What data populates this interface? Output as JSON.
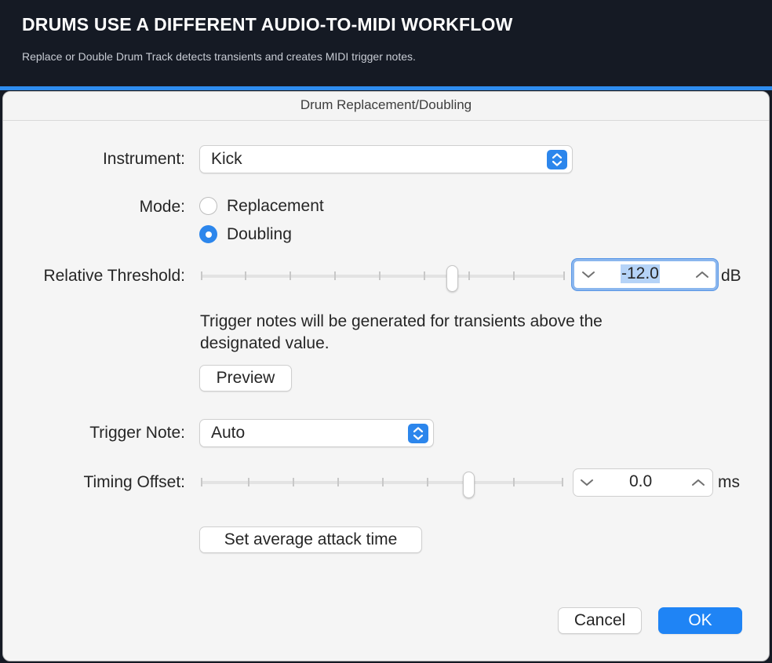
{
  "banner": {
    "title": "DRUMS USE A DIFFERENT AUDIO-TO-MIDI WORKFLOW",
    "subtitle": "Replace or Double Drum Track detects transients and creates MIDI trigger notes."
  },
  "dialog": {
    "title": "Drum Replacement/Doubling",
    "instrument": {
      "label": "Instrument:",
      "value": "Kick"
    },
    "mode": {
      "label": "Mode:",
      "options": [
        {
          "label": "Replacement",
          "selected": false
        },
        {
          "label": "Doubling",
          "selected": true
        }
      ]
    },
    "threshold": {
      "label": "Relative Threshold:",
      "value": "-12.0",
      "unit": "dB",
      "slider_position": 0.62,
      "help_line1": "Trigger notes will be generated for transients above the",
      "help_line2": "designated value.",
      "preview_label": "Preview"
    },
    "trigger_note": {
      "label": "Trigger Note:",
      "value": "Auto"
    },
    "timing_offset": {
      "label": "Timing Offset:",
      "value": "0.0",
      "unit": "ms",
      "slider_position": 0.74,
      "attack_button_label": "Set average attack time"
    },
    "buttons": {
      "cancel": "Cancel",
      "ok": "OK"
    }
  },
  "colors": {
    "accent": "#2c86ec",
    "primary_button": "#1f84f5",
    "banner_bg": "#151a24",
    "focus_ring": "#8ab6ee"
  }
}
